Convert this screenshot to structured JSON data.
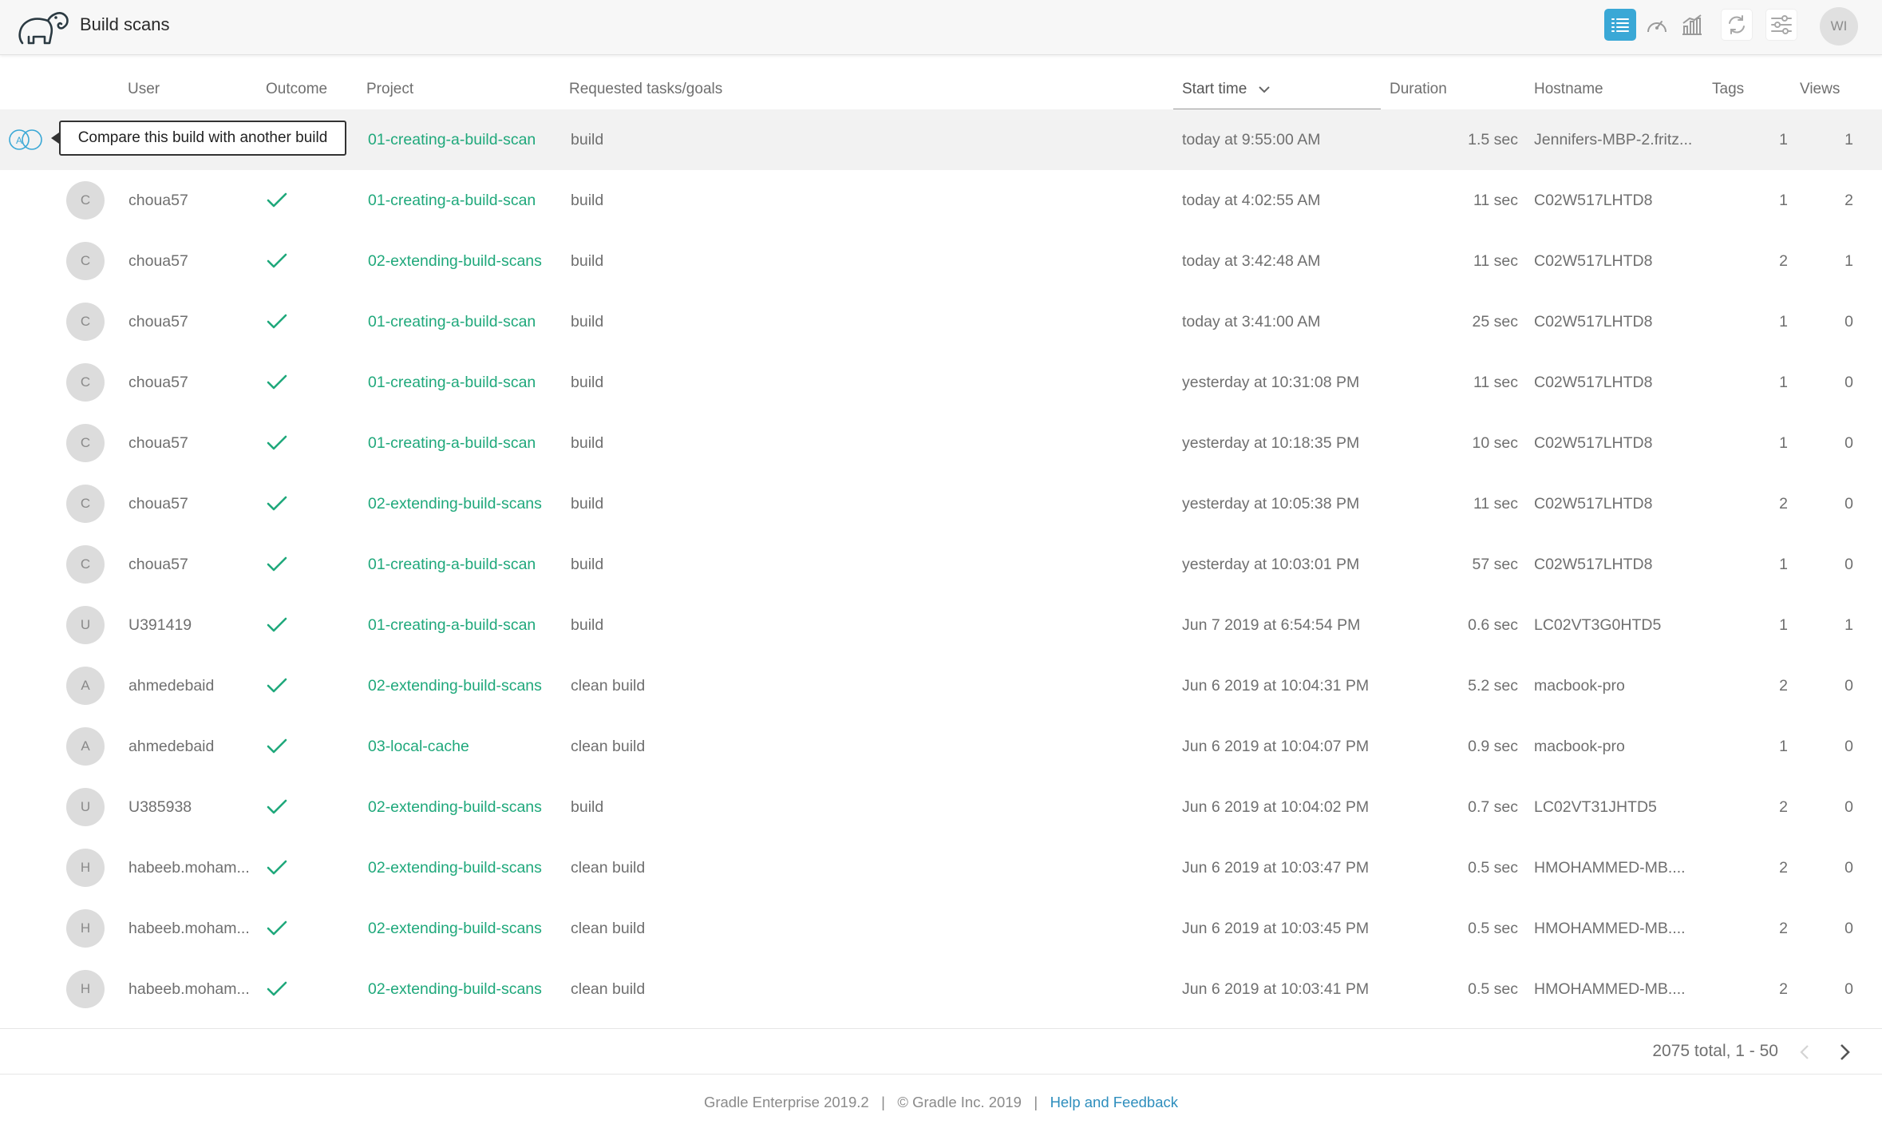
{
  "header": {
    "title": "Build scans",
    "user_initials": "WI",
    "toolbar": [
      "list-icon",
      "gauge-icon",
      "bar-chart-icon",
      "refresh-icon",
      "filter-sliders-icon"
    ]
  },
  "colors": {
    "accent_blue": "#3aa8d6",
    "link_green": "#1fa87b",
    "help_link": "#2e8ebd"
  },
  "table": {
    "columns": {
      "user": "User",
      "outcome": "Outcome",
      "project": "Project",
      "tasks": "Requested tasks/goals",
      "start_time": "Start time",
      "duration": "Duration",
      "hostname": "Hostname",
      "tags": "Tags",
      "views": "Views"
    },
    "sorted_by": "Start time",
    "tooltip": "Compare this build with another build",
    "rows": [
      {
        "initial": "",
        "user": "",
        "outcome": "",
        "project": "01-creating-a-build-scan",
        "tasks": "build",
        "start": "today at 9:55:00 AM",
        "duration": "1.5 sec",
        "hostname": "Jennifers-MBP-2.fritz...",
        "tags": "1",
        "views": "1"
      },
      {
        "initial": "C",
        "user": "choua57",
        "outcome": "success",
        "project": "01-creating-a-build-scan",
        "tasks": "build",
        "start": "today at 4:02:55 AM",
        "duration": "11 sec",
        "hostname": "C02W517LHTD8",
        "tags": "1",
        "views": "2"
      },
      {
        "initial": "C",
        "user": "choua57",
        "outcome": "success",
        "project": "02-extending-build-scans",
        "tasks": "build",
        "start": "today at 3:42:48 AM",
        "duration": "11 sec",
        "hostname": "C02W517LHTD8",
        "tags": "2",
        "views": "1"
      },
      {
        "initial": "C",
        "user": "choua57",
        "outcome": "success",
        "project": "01-creating-a-build-scan",
        "tasks": "build",
        "start": "today at 3:41:00 AM",
        "duration": "25 sec",
        "hostname": "C02W517LHTD8",
        "tags": "1",
        "views": "0"
      },
      {
        "initial": "C",
        "user": "choua57",
        "outcome": "success",
        "project": "01-creating-a-build-scan",
        "tasks": "build",
        "start": "yesterday at 10:31:08 PM",
        "duration": "11 sec",
        "hostname": "C02W517LHTD8",
        "tags": "1",
        "views": "0"
      },
      {
        "initial": "C",
        "user": "choua57",
        "outcome": "success",
        "project": "01-creating-a-build-scan",
        "tasks": "build",
        "start": "yesterday at 10:18:35 PM",
        "duration": "10 sec",
        "hostname": "C02W517LHTD8",
        "tags": "1",
        "views": "0"
      },
      {
        "initial": "C",
        "user": "choua57",
        "outcome": "success",
        "project": "02-extending-build-scans",
        "tasks": "build",
        "start": "yesterday at 10:05:38 PM",
        "duration": "11 sec",
        "hostname": "C02W517LHTD8",
        "tags": "2",
        "views": "0"
      },
      {
        "initial": "C",
        "user": "choua57",
        "outcome": "success",
        "project": "01-creating-a-build-scan",
        "tasks": "build",
        "start": "yesterday at 10:03:01 PM",
        "duration": "57 sec",
        "hostname": "C02W517LHTD8",
        "tags": "1",
        "views": "0"
      },
      {
        "initial": "U",
        "user": "U391419",
        "outcome": "success",
        "project": "01-creating-a-build-scan",
        "tasks": "build",
        "start": "Jun 7 2019 at 6:54:54 PM",
        "duration": "0.6 sec",
        "hostname": "LC02VT3G0HTD5",
        "tags": "1",
        "views": "1"
      },
      {
        "initial": "A",
        "user": "ahmedebaid",
        "outcome": "success",
        "project": "02-extending-build-scans",
        "tasks": "clean build",
        "start": "Jun 6 2019 at 10:04:31 PM",
        "duration": "5.2 sec",
        "hostname": "macbook-pro",
        "tags": "2",
        "views": "0"
      },
      {
        "initial": "A",
        "user": "ahmedebaid",
        "outcome": "success",
        "project": "03-local-cache",
        "tasks": "clean build",
        "start": "Jun 6 2019 at 10:04:07 PM",
        "duration": "0.9 sec",
        "hostname": "macbook-pro",
        "tags": "1",
        "views": "0"
      },
      {
        "initial": "U",
        "user": "U385938",
        "outcome": "success",
        "project": "02-extending-build-scans",
        "tasks": "build",
        "start": "Jun 6 2019 at 10:04:02 PM",
        "duration": "0.7 sec",
        "hostname": "LC02VT31JHTD5",
        "tags": "2",
        "views": "0"
      },
      {
        "initial": "H",
        "user": "habeeb.moham...",
        "outcome": "success",
        "project": "02-extending-build-scans",
        "tasks": "clean build",
        "start": "Jun 6 2019 at 10:03:47 PM",
        "duration": "0.5 sec",
        "hostname": "HMOHAMMED-MB....",
        "tags": "2",
        "views": "0"
      },
      {
        "initial": "H",
        "user": "habeeb.moham...",
        "outcome": "success",
        "project": "02-extending-build-scans",
        "tasks": "clean build",
        "start": "Jun 6 2019 at 10:03:45 PM",
        "duration": "0.5 sec",
        "hostname": "HMOHAMMED-MB....",
        "tags": "2",
        "views": "0"
      },
      {
        "initial": "H",
        "user": "habeeb.moham...",
        "outcome": "success",
        "project": "02-extending-build-scans",
        "tasks": "clean build",
        "start": "Jun 6 2019 at 10:03:41 PM",
        "duration": "0.5 sec",
        "hostname": "HMOHAMMED-MB....",
        "tags": "2",
        "views": "0"
      }
    ]
  },
  "pagination": {
    "summary": "2075 total, 1 - 50"
  },
  "footer": {
    "product": "Gradle Enterprise 2019.2",
    "copyright": "© Gradle Inc. 2019",
    "help_link": "Help and Feedback"
  }
}
